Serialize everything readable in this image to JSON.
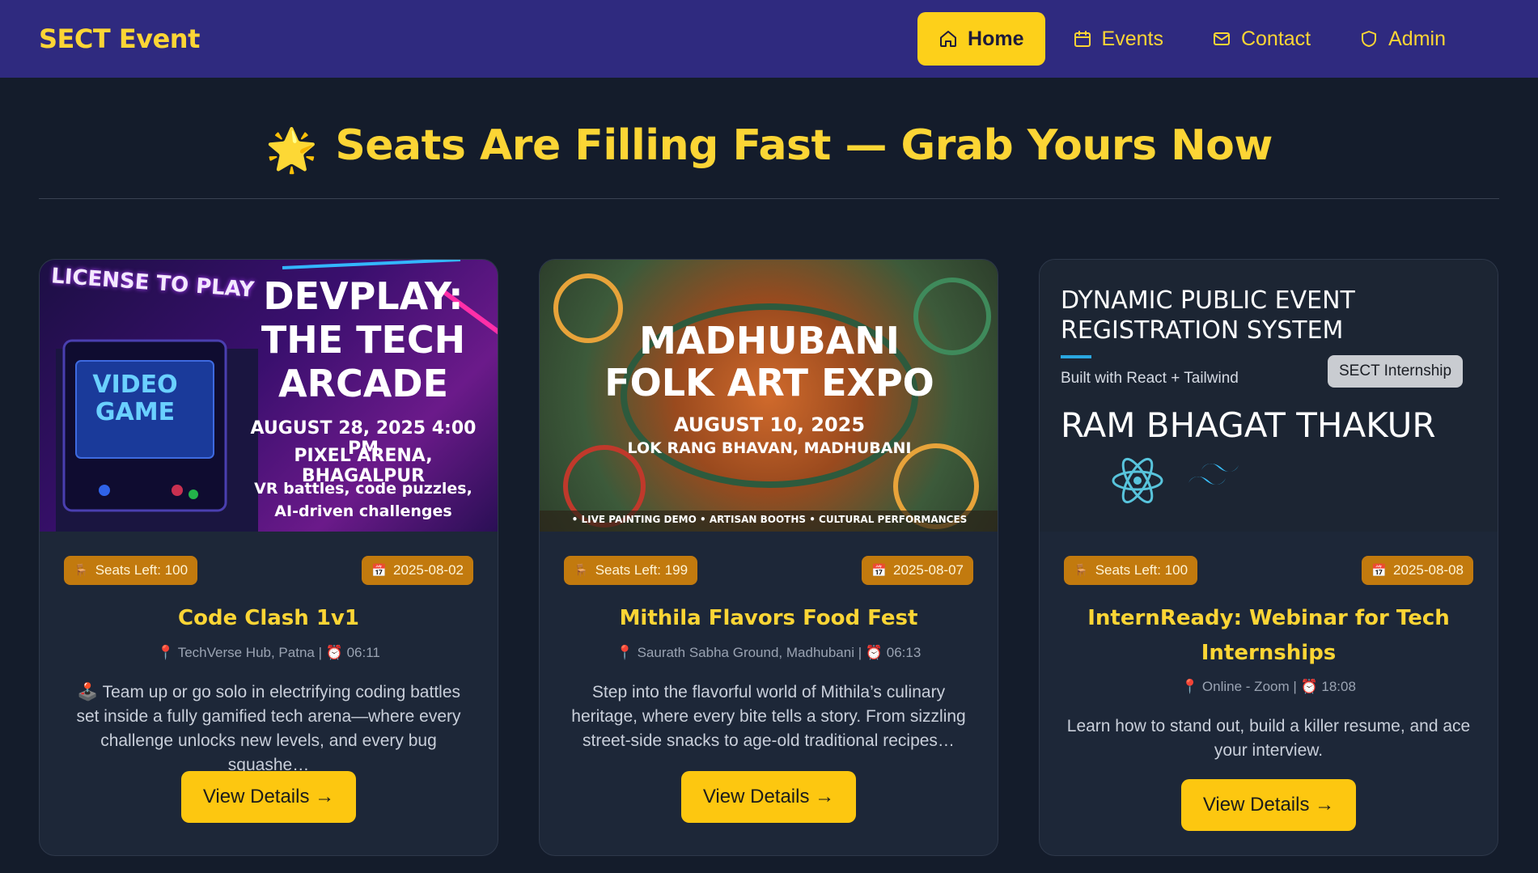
{
  "app": {
    "brand": "SECT Event"
  },
  "nav": {
    "items": [
      {
        "label": "Home",
        "icon": "home-icon",
        "active": true
      },
      {
        "label": "Events",
        "icon": "calendar-icon",
        "active": false
      },
      {
        "label": "Contact",
        "icon": "mail-icon",
        "active": false
      },
      {
        "label": "Admin",
        "icon": "shield-icon",
        "active": false
      }
    ]
  },
  "hero": {
    "title": "Seats Are Filling Fast — Grab Yours Now",
    "emoji": "🌟"
  },
  "colors": {
    "navbar": "#2f2a7f",
    "accent": "#fcd535",
    "button": "#fdc710",
    "badge": "#c27a0e",
    "background": "#141c2b",
    "card": "#1d2738"
  },
  "events": [
    {
      "seats": "Seats Left: 100",
      "date": "2025-08-02",
      "title": "Code Clash 1v1",
      "meta": "📍 TechVerse Hub, Patna | ⏰ 06:11",
      "description": "🕹️ Team up or go solo in electrifying coding battles set inside a fully gamified tech arena—where every challenge unlocks new levels, and every bug squashe…",
      "button": "View Details →",
      "poster": {
        "tag": "LICENSE TO PLAY",
        "screen": "VIDEO GAME",
        "headline": "DEVPLAY: THE TECH ARCADE",
        "headline_line1": "DEVPLAY:",
        "headline_line2": "THE TECH",
        "headline_line3": "ARCADE",
        "datetime": "AUGUST 28, 2025   4:00 PM",
        "venue": "PIXEL ARENA, BHAGALPUR",
        "tagline1": "VR battles, code puzzles,",
        "tagline2": "AI-driven challenges"
      }
    },
    {
      "seats": "Seats Left: 199",
      "date": "2025-08-07",
      "title": "Mithila Flavors Food Fest",
      "meta": "📍 Saurath Sabha Ground, Madhubani | ⏰ 06:13",
      "description": "Step into the flavorful world of Mithila’s culinary heritage, where every bite tells a story. From sizzling street-side snacks to age-old traditional recipes…",
      "button": "View Details →",
      "poster": {
        "headline_line1": "MADHUBANI",
        "headline_line2": "FOLK ART EXPO",
        "date": "AUGUST 10, 2025",
        "venue": "LOK RANG BHAVAN, MADHUBANI",
        "footer": "• LIVE PAINTING DEMO • ARTISAN BOOTHS • CULTURAL PERFORMANCES"
      }
    },
    {
      "seats": "Seats Left: 100",
      "date": "2025-08-08",
      "title": "InternReady: Webinar for Tech Internships",
      "meta": "📍 Online - Zoom | ⏰ 18:08",
      "description": "Learn how to stand out, build a killer resume, and ace your interview.",
      "button": "View Details →",
      "poster": {
        "headline_line1": "DYNAMIC PUBLIC EVENT",
        "headline_line2": "REGISTRATION SYSTEM",
        "built_with": "Built with React + Tailwind",
        "tag": "SECT Internship",
        "author": "RAM BHAGAT THAKUR"
      }
    }
  ]
}
